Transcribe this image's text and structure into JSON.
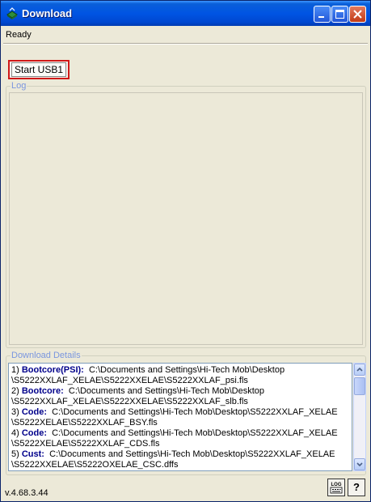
{
  "window": {
    "title": "Download"
  },
  "status": {
    "text": "Ready"
  },
  "actions": {
    "start_label": "Start USB1"
  },
  "log": {
    "label": "Log"
  },
  "download_details": {
    "label": "Download Details",
    "items": [
      {
        "index": "1)",
        "key": "Bootcore(PSI):",
        "line1": "C:\\Documents and Settings\\Hi-Tech Mob\\Desktop",
        "line2": "\\S5222XXLAF_XELAE\\S5222XXELAE\\S5222XXLAF_psi.fls"
      },
      {
        "index": "2)",
        "key": "Bootcore:",
        "line1": "C:\\Documents and Settings\\Hi-Tech Mob\\Desktop",
        "line2": "\\S5222XXLAF_XELAE\\S5222XXELAE\\S5222XXLAF_slb.fls"
      },
      {
        "index": "3)",
        "key": "Code:",
        "line1": "C:\\Documents and Settings\\Hi-Tech Mob\\Desktop\\S5222XXLAF_XELAE",
        "line2": "\\S5222XELAE\\S5222XXLAF_BSY.fls"
      },
      {
        "index": "4)",
        "key": "Code:",
        "line1": "C:\\Documents and Settings\\Hi-Tech Mob\\Desktop\\S5222XXLAF_XELAE",
        "line2": "\\S5222XELAE\\S5222XXLAF_CDS.fls"
      },
      {
        "index": "5)",
        "key": "Cust:",
        "line1": "C:\\Documents and Settings\\Hi-Tech Mob\\Desktop\\S5222XXLAF_XELAE",
        "line2": "\\S5222XXELAE\\S5222OXELAE_CSC.dffs"
      }
    ]
  },
  "footer": {
    "version": "v.4.68.3.44",
    "log_icon_text": "LOG",
    "help_label": "?"
  },
  "colors": {
    "titlebar": "#0054e3",
    "highlight_border": "#d01818",
    "group_label": "#7a96df",
    "detail_key": "#00008b"
  }
}
